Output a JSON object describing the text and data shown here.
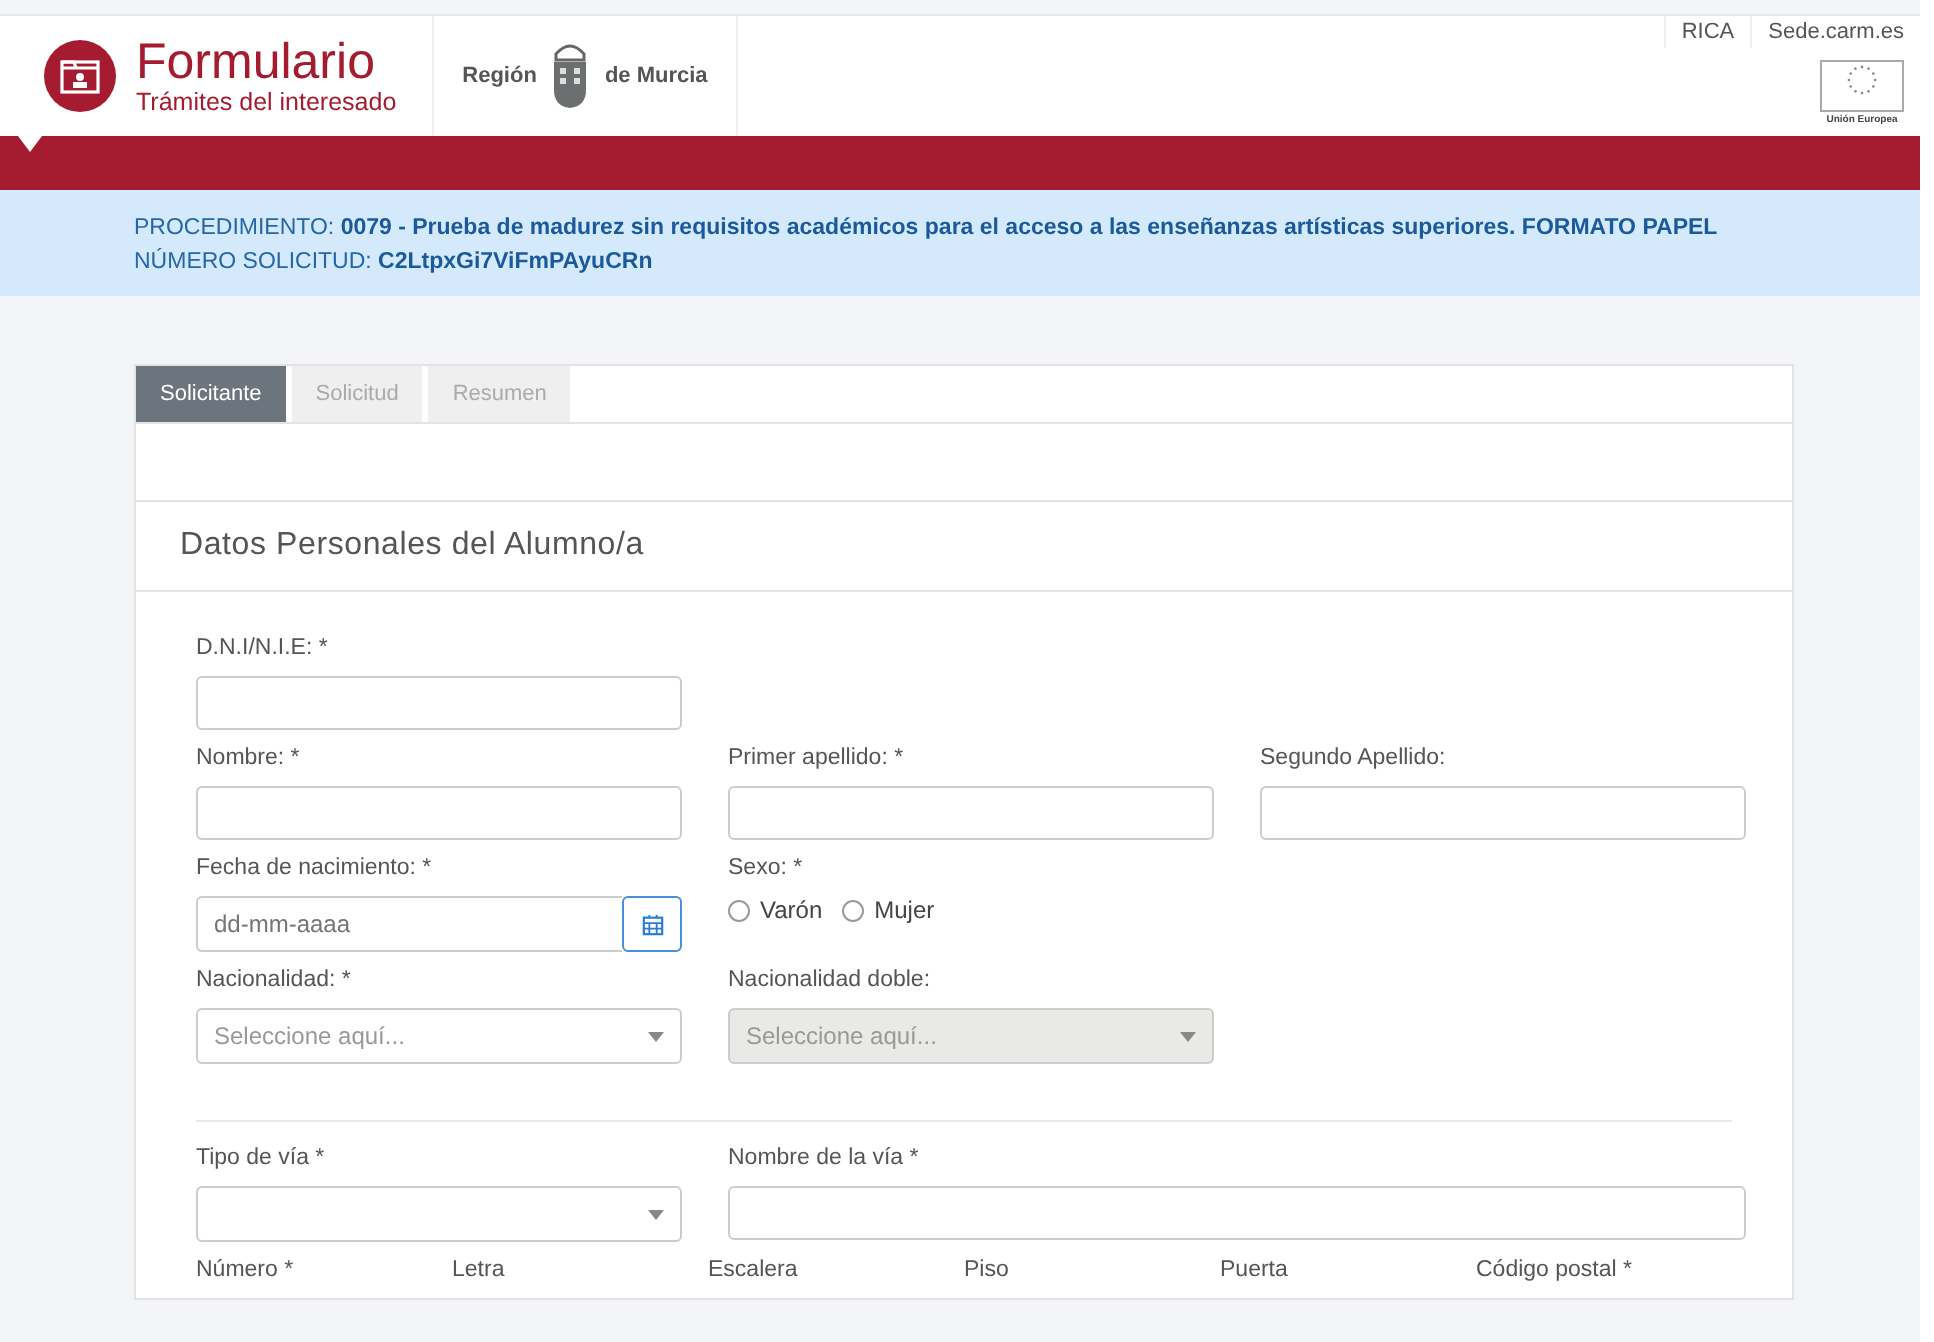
{
  "header": {
    "title": "Formulario",
    "subtitle": "Trámites del interesado",
    "region_left": "Región",
    "region_right": "de Murcia",
    "links": [
      "RICA",
      "Sede.carm.es"
    ],
    "eu_label": "Unión Europea"
  },
  "procedure": {
    "label": "PROCEDIMIENTO:",
    "value": "0079 - Prueba de madurez sin requisitos académicos para el acceso a las enseñanzas artísticas superiores. FORMATO PAPEL",
    "number_label": "NÚMERO SOLICITUD:",
    "number_value": "C2LtpxGi7ViFmPAyuCRn"
  },
  "tabs": [
    {
      "label": "Solicitante",
      "selected": true
    },
    {
      "label": "Solicitud",
      "selected": false
    },
    {
      "label": "Resumen",
      "selected": false
    }
  ],
  "section_title": "Datos Personales del Alumno/a",
  "groups": [
    [
      [
        {
          "kind": "text",
          "label": "D.N.I/N.I.E: *"
        }
      ],
      [
        {
          "kind": "text",
          "label": "Nombre: *"
        },
        {
          "kind": "text",
          "label": "Primer apellido: *"
        },
        {
          "kind": "text",
          "label": "Segundo Apellido:"
        }
      ],
      [
        {
          "kind": "date",
          "label": "Fecha de nacimiento: *",
          "placeholder": "dd-mm-aaaa"
        },
        {
          "kind": "radio",
          "label": "Sexo: *",
          "options": [
            {
              "label": "Varón",
              "checked": false
            },
            {
              "label": "Mujer",
              "checked": false
            }
          ]
        }
      ],
      [
        {
          "kind": "select",
          "label": "Nacionalidad: *",
          "placeholder": "Seleccione aquí...",
          "disabled": false
        },
        {
          "kind": "select",
          "label": "Nacionalidad doble:",
          "placeholder": "Seleccione aquí...",
          "disabled": true
        }
      ]
    ],
    [
      [
        {
          "kind": "select",
          "label": "Tipo de vía *",
          "disabled": false
        },
        {
          "kind": "wide_text",
          "label": "Nombre de la vía *"
        }
      ],
      [
        {
          "kind": "label",
          "label": "Número *"
        },
        {
          "kind": "label",
          "label": "Letra"
        },
        {
          "kind": "label",
          "label": "Escalera"
        },
        {
          "kind": "label",
          "label": "Piso"
        },
        {
          "kind": "label",
          "label": "Puerta"
        },
        {
          "kind": "label",
          "label": "Código postal *"
        }
      ]
    ]
  ]
}
